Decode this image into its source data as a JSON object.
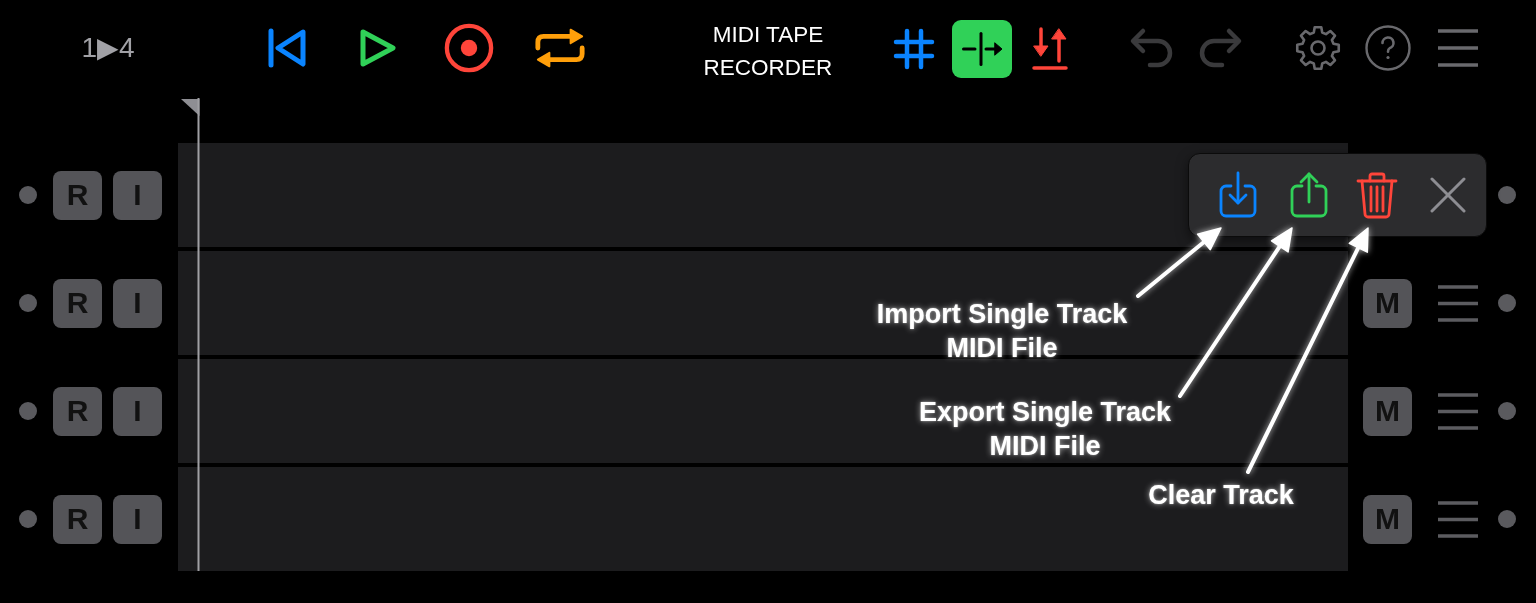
{
  "toolbar": {
    "bar_range": "1▶4",
    "transport": [
      {
        "kind": "skip_back"
      },
      {
        "kind": "play"
      },
      {
        "kind": "record"
      },
      {
        "kind": "loop"
      }
    ],
    "title_lines": [
      "MIDI TAPE",
      "RECORDER"
    ],
    "edit_tools": [
      {
        "kind": "grid",
        "selected": false
      },
      {
        "kind": "split",
        "selected": true
      },
      {
        "kind": "shift",
        "selected": false
      }
    ],
    "history": [
      {
        "kind": "undo",
        "disabled": true
      },
      {
        "kind": "redo",
        "disabled": true
      }
    ],
    "utilities": [
      {
        "kind": "settings"
      },
      {
        "kind": "help"
      },
      {
        "kind": "menu"
      }
    ]
  },
  "tracks": [
    {
      "record_label": "R",
      "input_label": "I"
    },
    {
      "record_label": "R",
      "input_label": "I",
      "mute_label": "M"
    },
    {
      "record_label": "R",
      "input_label": "I",
      "mute_label": "M"
    },
    {
      "record_label": "R",
      "input_label": "I",
      "mute_label": "M"
    }
  ],
  "track_popup": {
    "actions": [
      {
        "kind": "import"
      },
      {
        "kind": "export"
      },
      {
        "kind": "clear"
      },
      {
        "kind": "close"
      }
    ]
  },
  "callouts": [
    {
      "lines": [
        "Import Single Track",
        "MIDI File"
      ]
    },
    {
      "lines": [
        "Export Single Track",
        "MIDI File"
      ]
    },
    {
      "lines": [
        "Clear Track"
      ]
    }
  ]
}
